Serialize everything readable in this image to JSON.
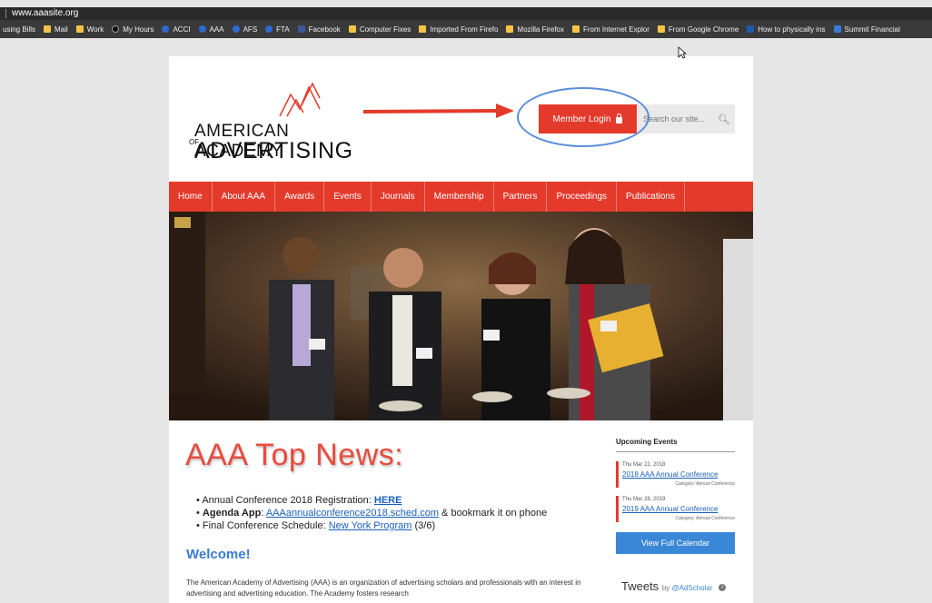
{
  "browser": {
    "url": "www.aaasite.org",
    "bookmarks": [
      {
        "label": "using Bills",
        "icon": "none"
      },
      {
        "label": "Mail",
        "icon": "folder-icon"
      },
      {
        "label": "Work",
        "icon": "folder-icon"
      },
      {
        "label": "My Hours",
        "icon": "clock-icon"
      },
      {
        "label": "ACCI",
        "icon": "globe-icon"
      },
      {
        "label": "AAA",
        "icon": "globe-icon"
      },
      {
        "label": "AFS",
        "icon": "globe-icon"
      },
      {
        "label": "FTA",
        "icon": "globe-icon"
      },
      {
        "label": "Facebook",
        "icon": "facebook-icon"
      },
      {
        "label": "Computer Fixes",
        "icon": "folder-icon"
      },
      {
        "label": "Imported From Firefo",
        "icon": "folder-icon"
      },
      {
        "label": "Mozilla Firefox",
        "icon": "folder-icon"
      },
      {
        "label": "From Internet Explor",
        "icon": "folder-icon"
      },
      {
        "label": "From Google Chrome",
        "icon": "folder-icon"
      },
      {
        "label": "How to physically ins",
        "icon": "ms-icon"
      },
      {
        "label": "Summit Financial",
        "icon": "chart-icon"
      }
    ]
  },
  "header": {
    "logo_line1": "AMERICAN ACADEMY",
    "logo_of": "OF",
    "logo_line2": "ADVERTISING",
    "login_label": "Member Login",
    "search_placeholder": "Search our site..."
  },
  "nav": {
    "items": [
      "Home",
      "About AAA",
      "Awards",
      "Events",
      "Journals",
      "Membership",
      "Partners",
      "Proceedings",
      "Publications"
    ]
  },
  "main": {
    "news_title": "AAA Top News:",
    "bullet1_text": "Annual Conference 2018 Registration: ",
    "bullet1_link": "HERE",
    "bullet2_bold": "Agenda App",
    "bullet2_colon": ": ",
    "bullet2_link": "AAAannualconference2018.sched.com",
    "bullet2_tail": " & bookmark it on phone",
    "bullet3_text": "Final Conference Schedule: ",
    "bullet3_link": "New York Program",
    "bullet3_tail": " (3/6)",
    "welcome": "Welcome!",
    "intro": "The American Academy of Advertising (AAA) is an organization of advertising scholars and professionals with an interest in advertising and advertising education. The Academy fosters research"
  },
  "sidebar": {
    "events_heading": "Upcoming Events",
    "events": [
      {
        "date": "Thu Mar 22, 2018",
        "name": "2018 AAA Annual Conference",
        "category": "Category: Annual Conference"
      },
      {
        "date": "Thu Mar 28, 2019",
        "name": "2019 AAA Annual Conference",
        "category": "Category: Annual Conference"
      }
    ],
    "calendar_button": "View Full Calendar",
    "tweets_label": "Tweets",
    "tweets_by": "by ",
    "tweets_handle": "@AdScholar"
  },
  "colors": {
    "accent_red": "#e43a2b",
    "link_blue": "#1a5fbd",
    "button_blue": "#3a87d8",
    "annotation_blue": "#5a8fd8"
  }
}
